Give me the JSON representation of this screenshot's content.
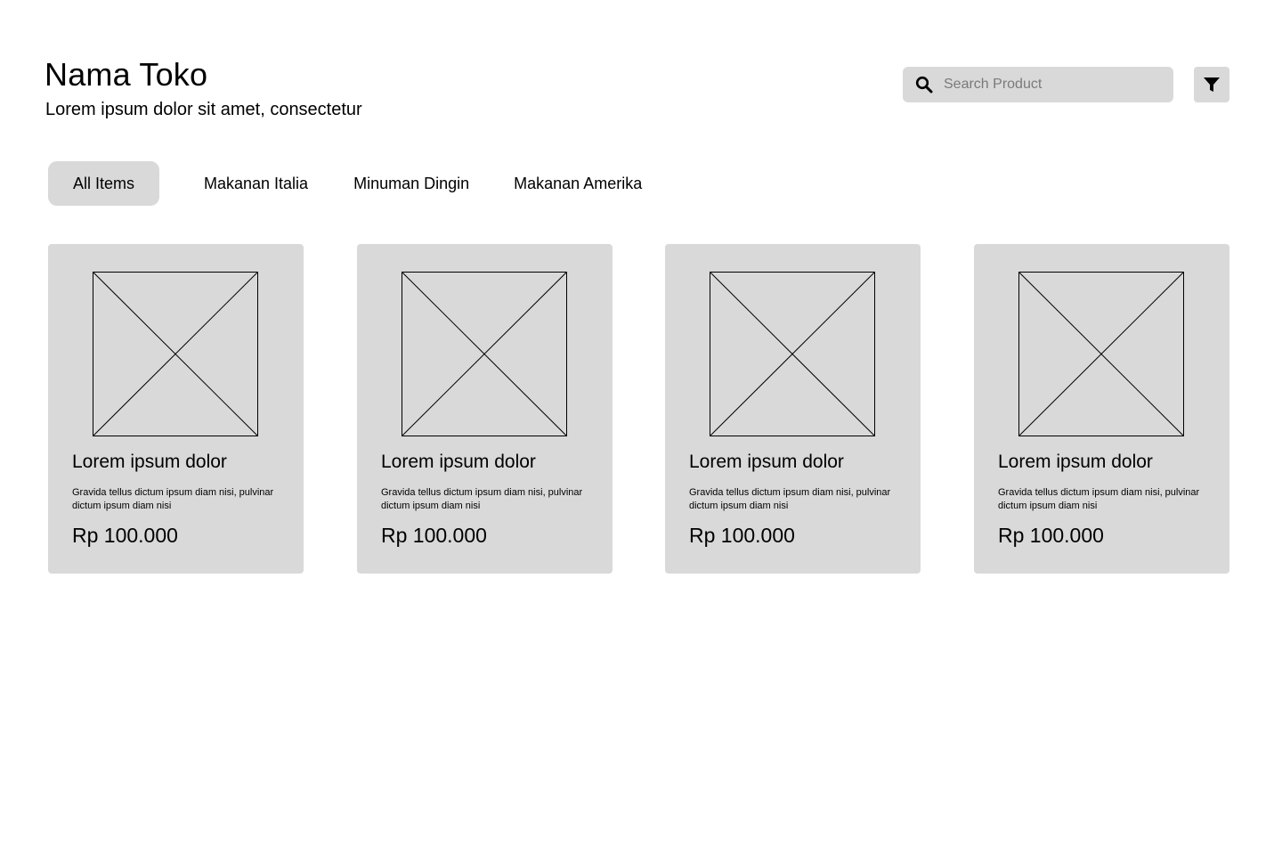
{
  "header": {
    "title": "Nama Toko",
    "subtitle": "Lorem ipsum dolor sit amet, consectetur"
  },
  "search": {
    "placeholder": "Search Product",
    "value": "",
    "icon": "search-icon"
  },
  "filter": {
    "icon": "filter-icon"
  },
  "tabs": [
    {
      "label": "All Items",
      "active": true
    },
    {
      "label": "Makanan Italia",
      "active": false
    },
    {
      "label": "Minuman Dingin",
      "active": false
    },
    {
      "label": "Makanan Amerika",
      "active": false
    }
  ],
  "products": [
    {
      "image": "image-placeholder-icon",
      "title": "Lorem ipsum dolor",
      "description": "Gravida tellus dictum ipsum diam nisi, pulvinar dictum ipsum diam nisi",
      "price": "Rp 100.000"
    },
    {
      "image": "image-placeholder-icon",
      "title": "Lorem ipsum dolor",
      "description": "Gravida tellus dictum ipsum diam nisi, pulvinar dictum ipsum diam nisi",
      "price": "Rp 100.000"
    },
    {
      "image": "image-placeholder-icon",
      "title": "Lorem ipsum dolor",
      "description": "Gravida tellus dictum ipsum diam nisi, pulvinar dictum ipsum diam nisi",
      "price": "Rp 100.000"
    },
    {
      "image": "image-placeholder-icon",
      "title": "Lorem ipsum dolor",
      "description": "Gravida tellus dictum ipsum diam nisi, pulvinar dictum ipsum diam nisi",
      "price": "Rp 100.000"
    }
  ],
  "colors": {
    "surface": "#d9d9d9",
    "background": "#ffffff",
    "text": "#000000",
    "placeholder_text": "#7a7a7a"
  }
}
